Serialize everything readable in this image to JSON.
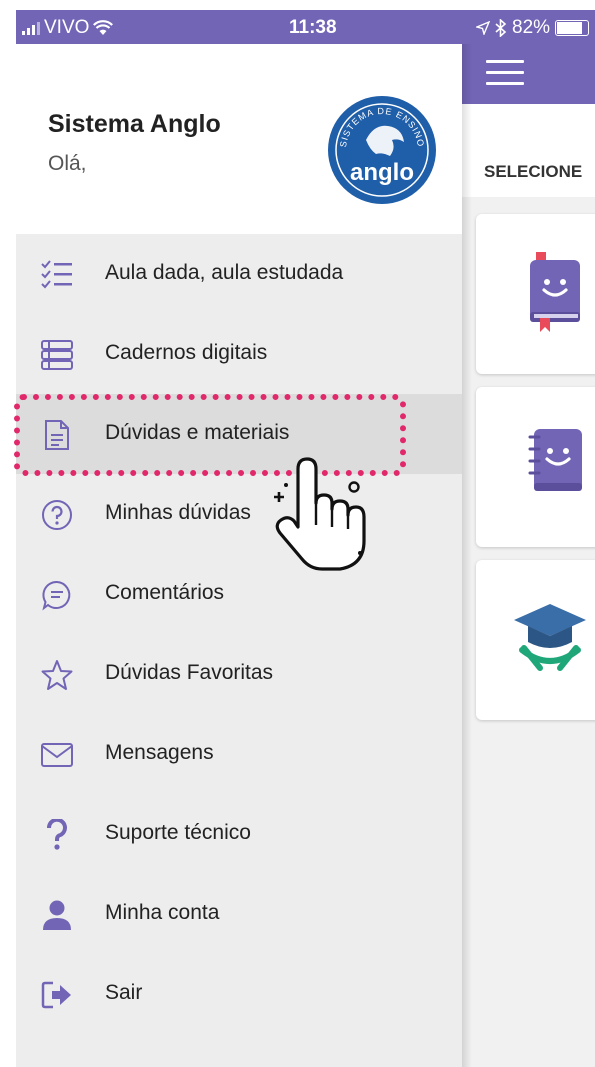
{
  "status_bar": {
    "carrier": "VIVO",
    "time": "11:38",
    "battery": "82%"
  },
  "drawer": {
    "title": "Sistema Anglo",
    "greeting": "Olá,",
    "logo": {
      "name": "anglo",
      "ring_text": "SISTEMA DE ENSINO"
    },
    "items": [
      {
        "label": "Aula dada, aula estudada",
        "icon": "checklist-icon"
      },
      {
        "label": "Cadernos digitais",
        "icon": "stacked-books-icon"
      },
      {
        "label": "Dúvidas e materiais",
        "icon": "document-icon"
      },
      {
        "label": "Minhas dúvidas",
        "icon": "question-circle-icon"
      },
      {
        "label": "Comentários",
        "icon": "comment-icon"
      },
      {
        "label": "Dúvidas Favoritas",
        "icon": "star-icon"
      },
      {
        "label": "Mensagens",
        "icon": "envelope-icon"
      },
      {
        "label": "Suporte técnico",
        "icon": "question-mark-icon"
      },
      {
        "label": "Minha conta",
        "icon": "user-icon"
      },
      {
        "label": "Sair",
        "icon": "logout-icon"
      }
    ],
    "active_index": 2
  },
  "main": {
    "select_label": "SELECIONE"
  },
  "colors": {
    "brand": "#7265b6",
    "highlight": "#e0286a",
    "logo_blue": "#1f5ea8",
    "drawer_bg": "#ededed"
  }
}
